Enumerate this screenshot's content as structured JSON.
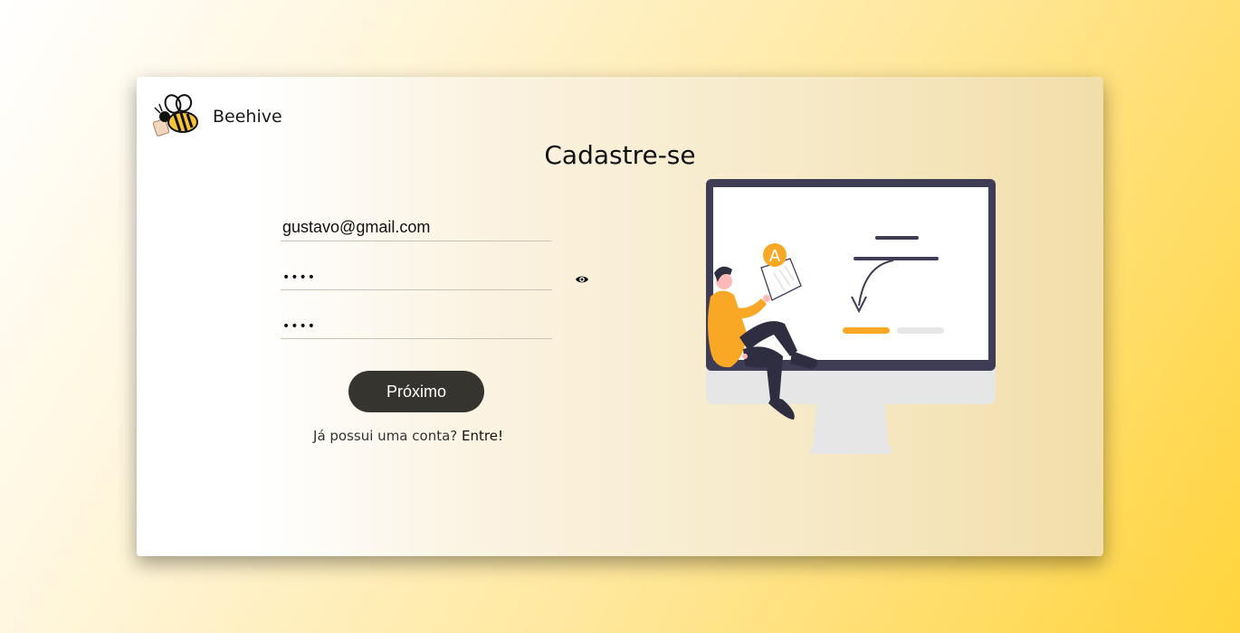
{
  "brand": {
    "name": "Beehive",
    "logo_icon": "bee-icon"
  },
  "form": {
    "title": "Cadastre-se",
    "email_value": "gustavo@gmail.com",
    "password_masked": "••••",
    "confirm_masked": "••••",
    "show_password_icon": "eye-icon",
    "submit_label": "Próximo",
    "login_prompt": "Já possui uma conta?",
    "login_link_label": "Entre!"
  },
  "illustration": {
    "badge_letter": "A",
    "icon": "person-with-monitor-illustration"
  },
  "colors": {
    "accent": "#f9a826",
    "button_bg": "#36342f",
    "monitor_frame": "#3f3d56"
  }
}
